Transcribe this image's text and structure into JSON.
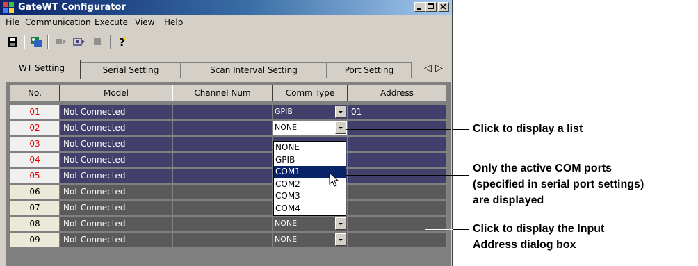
{
  "window": {
    "title": "GateWT Configurator"
  },
  "menu": [
    "File",
    "Communication",
    "Execute",
    "View",
    "Help"
  ],
  "toolbar": {
    "icons": [
      "save-icon",
      "connect-icon",
      "step-icon",
      "run-icon",
      "stop-icon",
      "help-icon"
    ]
  },
  "tabs": [
    "WT Setting",
    "Serial Setting",
    "Scan Interval Setting",
    "Port Setting"
  ],
  "tab_arrows": {
    "left": "◁",
    "right": "▷"
  },
  "grid": {
    "headers": [
      "No.",
      "Model",
      "Channel Num",
      "Comm Type",
      "Address"
    ],
    "rows": [
      {
        "no": "01",
        "model": "Not Connected",
        "comm": "GPIB",
        "address": "01"
      },
      {
        "no": "02",
        "model": "Not Connected",
        "comm": "NONE",
        "address": ""
      },
      {
        "no": "03",
        "model": "Not Connected",
        "comm": "",
        "address": ""
      },
      {
        "no": "04",
        "model": "Not Connected",
        "comm": "",
        "address": ""
      },
      {
        "no": "05",
        "model": "Not Connected",
        "comm": "",
        "address": ""
      },
      {
        "no": "06",
        "model": "Not Connected",
        "comm": "",
        "address": ""
      },
      {
        "no": "07",
        "model": "Not Connected",
        "comm": "NONE",
        "address": ""
      },
      {
        "no": "08",
        "model": "Not Connected",
        "comm": "NONE",
        "address": ""
      },
      {
        "no": "09",
        "model": "Not Connected",
        "comm": "NONE",
        "address": ""
      }
    ]
  },
  "dropdown": {
    "options": [
      "NONE",
      "GPIB",
      "COM1",
      "COM2",
      "COM3",
      "COM4"
    ],
    "selected": "COM1"
  },
  "annotations": {
    "list": "Click to display a list",
    "active_line1": "Only the active COM ports",
    "active_line2": "(specified in serial port settings)",
    "active_line3": "are displayed",
    "address_line1": "Click to display the Input",
    "address_line2": "Address dialog box"
  }
}
